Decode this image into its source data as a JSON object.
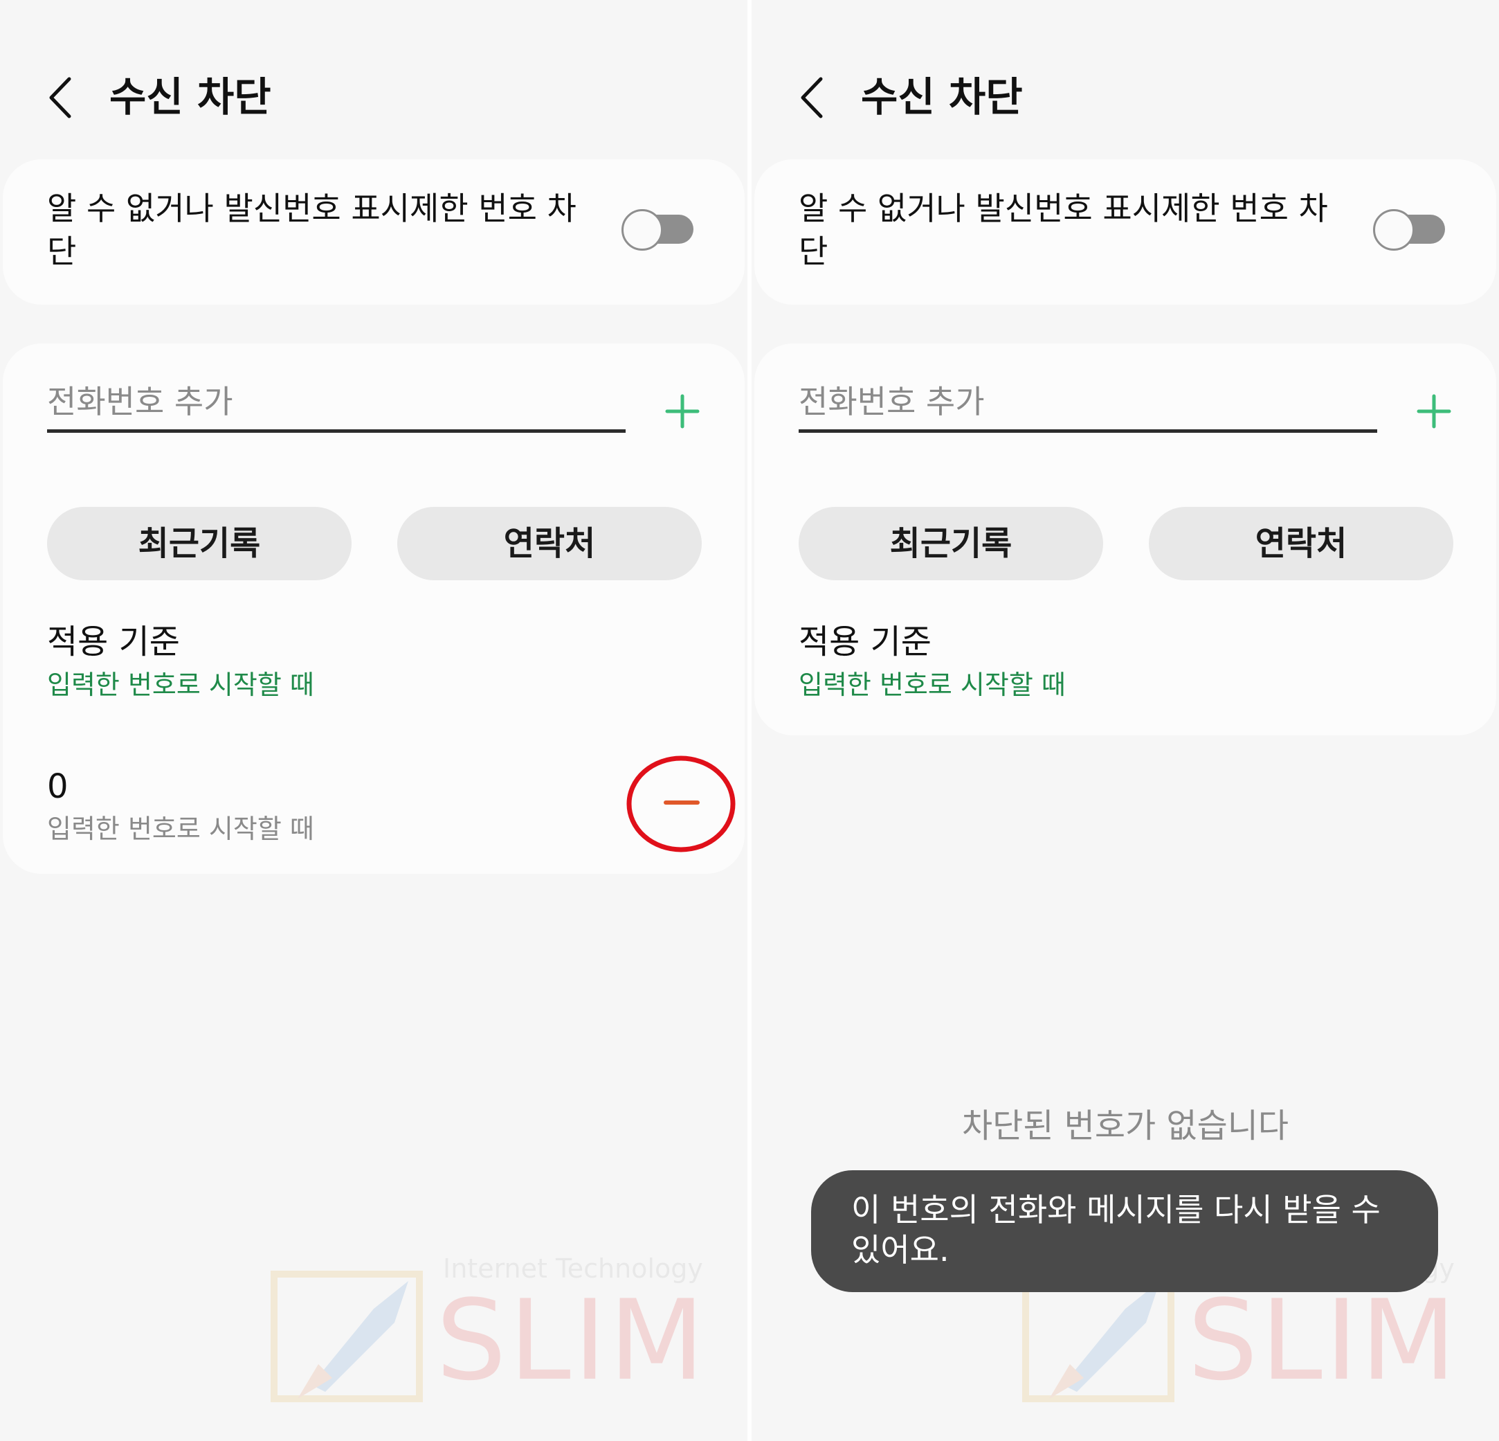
{
  "header": {
    "title": "수신 차단"
  },
  "unknown_toggle": {
    "label": "알 수 없거나 발신번호 표시제한 번호 차단",
    "enabled": false
  },
  "add_number": {
    "placeholder": "전화번호 추가"
  },
  "buttons": {
    "recent": "최근기록",
    "contacts": "연락처"
  },
  "criteria": {
    "title": "적용 기준",
    "value": "입력한 번호로 시작할 때"
  },
  "left_entries": [
    {
      "number": "0",
      "rule": "입력한 번호로 시작할 때"
    }
  ],
  "right_state": {
    "empty_message": "차단된 번호가 없습니다",
    "toast": "이 번호의 전화와 메시지를 다시 받을 수 있어요."
  },
  "watermark": {
    "caption": "Internet Technology",
    "brand": "SLIM"
  },
  "colors": {
    "accent_green": "#3dbd7a",
    "criteria_green": "#1f8a49",
    "remove_orange": "#e0582a",
    "annotation_red": "#e0101a"
  }
}
